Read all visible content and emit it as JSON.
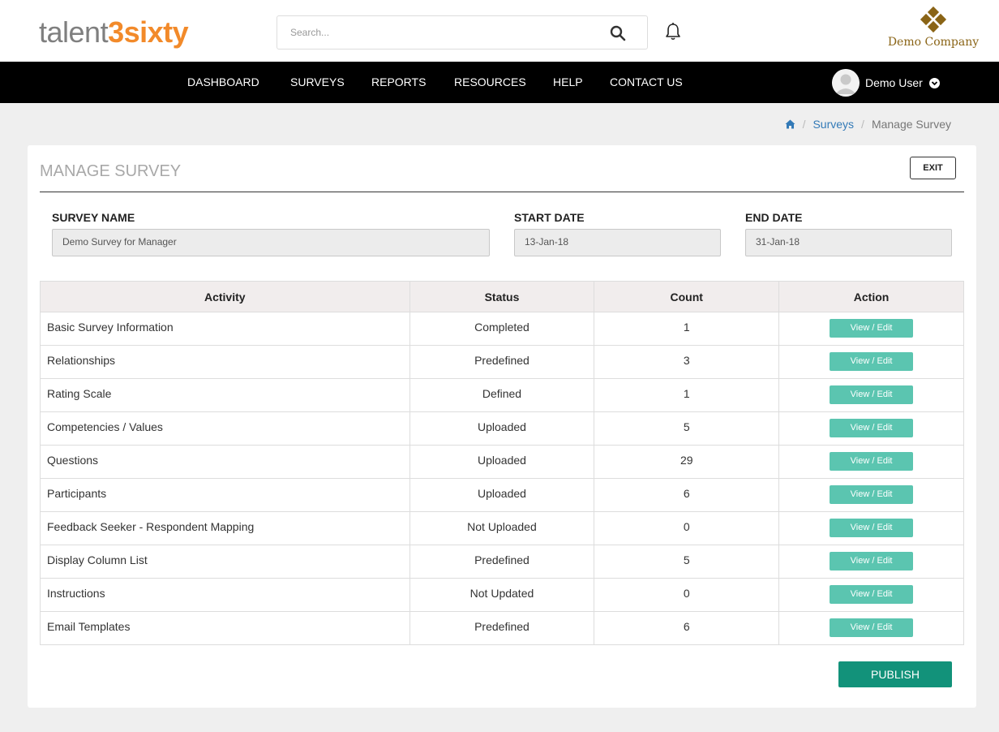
{
  "header": {
    "logo_part1": "talent",
    "logo_part2": "3sixty",
    "search_placeholder": "Search...",
    "company_name": "Demo Company"
  },
  "nav": {
    "items": [
      {
        "label": "DASHBOARD"
      },
      {
        "label": "SURVEYS"
      },
      {
        "label": "REPORTS"
      },
      {
        "label": "RESOURCES"
      },
      {
        "label": "HELP"
      },
      {
        "label": "CONTACT US"
      }
    ],
    "user_name": "Demo User"
  },
  "breadcrumb": {
    "items": [
      "Surveys",
      "Manage Survey"
    ]
  },
  "panel": {
    "title": "MANAGE SURVEY",
    "exit_label": "EXIT",
    "survey_name_label": "SURVEY NAME",
    "survey_name_value": "Demo Survey for Manager",
    "start_date_label": "START DATE",
    "start_date_value": "13-Jan-18",
    "end_date_label": "END DATE",
    "end_date_value": "31-Jan-18",
    "publish_label": "PUBLISH"
  },
  "table": {
    "headers": [
      "Activity",
      "Status",
      "Count",
      "Action"
    ],
    "action_label": "View / Edit",
    "rows": [
      {
        "activity": "Basic Survey Information",
        "status": "Completed",
        "count": "1"
      },
      {
        "activity": "Relationships",
        "status": "Predefined",
        "count": "3"
      },
      {
        "activity": "Rating Scale",
        "status": "Defined",
        "count": "1"
      },
      {
        "activity": "Competencies / Values",
        "status": "Uploaded",
        "count": "5"
      },
      {
        "activity": "Questions",
        "status": "Uploaded",
        "count": "29"
      },
      {
        "activity": "Participants",
        "status": "Uploaded",
        "count": "6"
      },
      {
        "activity": "Feedback Seeker - Respondent Mapping",
        "status": "Not Uploaded",
        "count": "0"
      },
      {
        "activity": "Display Column List",
        "status": "Predefined",
        "count": "5"
      },
      {
        "activity": "Instructions",
        "status": "Not Updated",
        "count": "0"
      },
      {
        "activity": "Email Templates",
        "status": "Predefined",
        "count": "6"
      }
    ]
  },
  "colors": {
    "logo_gray": "#7f7f7f",
    "logo_orange": "#f28a2a",
    "nav_bg": "#000000",
    "link_blue": "#337ab7",
    "teal_button": "#5bc5b0",
    "publish_green": "#12927a",
    "brand_gold": "#8a6416"
  }
}
